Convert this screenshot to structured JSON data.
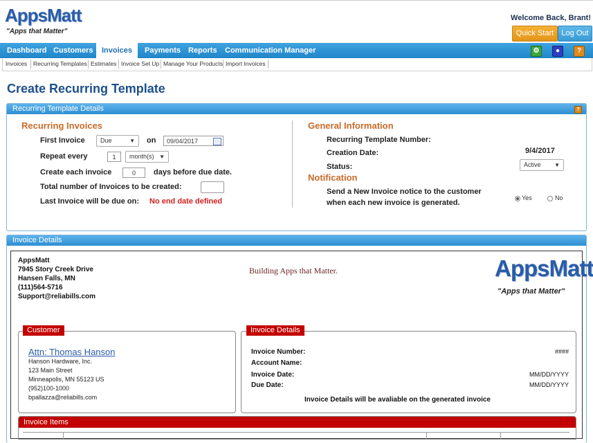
{
  "header": {
    "logo_text": "AppsMatt",
    "logo_tagline": "\"Apps that Matter\"",
    "welcome": "Welcome Back, Brant!",
    "quick_start_label": "Quick Start",
    "logout_label": "Log Out"
  },
  "nav": {
    "items": [
      "Dashboard",
      "Customers",
      "Invoices",
      "Payments",
      "Reports",
      "Communication Manager"
    ],
    "active": "Invoices",
    "icons": [
      "gear-icon",
      "user-icon",
      "help-icon"
    ]
  },
  "subnav": {
    "items": [
      "Invoices",
      "Recurring Templates",
      "Estimates",
      "Invoice Set Up",
      "Manage Your Products",
      "Import Invoices"
    ]
  },
  "page_title": "Create Recurring Template",
  "template_details": {
    "panel_title": "Recurring Template Details",
    "help": "?",
    "recurring": {
      "title": "Recurring Invoices",
      "first_invoice_label": "First Invoice",
      "first_invoice_select": "Due",
      "on_label": "on",
      "date_value": "09/04/2017",
      "repeat_every_label": "Repeat every",
      "repeat_value": "1",
      "repeat_unit": "month(s)",
      "create_each_label": "Create each invoice",
      "create_each_value": "0",
      "days_before_label": "days before due date.",
      "total_number_label": "Total number of Invoices to be created:",
      "total_number_value": "",
      "last_invoice_label": "Last Invoice will be due on:",
      "last_invoice_value": "No end date defined"
    },
    "general": {
      "title": "General Information",
      "template_number_label": "Recurring Template Number:",
      "template_number_value": "",
      "creation_date_label": "Creation Date:",
      "creation_date_value": "9/4/2017",
      "status_label": "Status:",
      "status_value": "Active"
    },
    "notification": {
      "title": "Notification",
      "text_line1": "Send a New Invoice notice to the customer",
      "text_line2": "when each new invoice is generated.",
      "yes_label": "Yes",
      "no_label": "No",
      "selected": "Yes"
    }
  },
  "invoice_details": {
    "panel_title": "Invoice Details",
    "company": {
      "name": "AppsMatt",
      "address1": "7945 Story Creek Drive",
      "address2": "Hansen Falls, MN",
      "phone": "(111)564-5716",
      "email": "Support@reliabills.com",
      "slogan": "Building Apps that Matter.",
      "logo_text": "AppsMatt",
      "logo_tagline": "\"Apps that Matter\""
    },
    "customer": {
      "tab": "Customer",
      "attn": "Attn: Thomas Hanson",
      "company": "Hanson Hardware, Inc.",
      "street": "123 Main Street",
      "city": "Minneapolis, MN 55123 US",
      "phone": "(952)100-1000",
      "email": "bpallazza@reliabills.com"
    },
    "details": {
      "tab": "Invoice Details",
      "number_label": "Invoice Number:",
      "number_value": "####",
      "account_label": "Account Name:",
      "account_value": "",
      "date_label": "Invoice Date:",
      "date_value": "MM/DD/YYYY",
      "due_label": "Due Date:",
      "due_value": "MM/DD/YYYY",
      "note": "Invoice Details will be avaliable on the generated invoice"
    },
    "items_tab": "Invoice Items"
  },
  "colors": {
    "nav_blue": "#1f86c9",
    "title_blue": "#1d4f8c",
    "section_orange": "#c86a2a",
    "invoice_red": "#c30000",
    "quick_start_orange": "#e3951a"
  }
}
